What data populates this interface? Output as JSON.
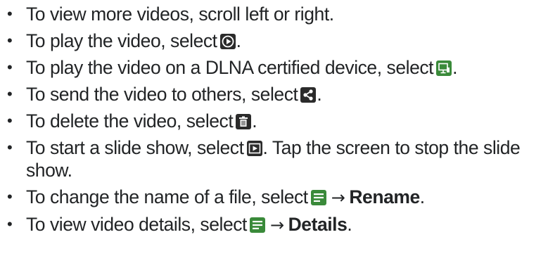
{
  "items": [
    {
      "text": "To view more videos, scroll left or right."
    },
    {
      "before": "To play the video, select",
      "after": ".",
      "icon": "play-circle-icon"
    },
    {
      "before": "To play the video on a DLNA certified device, select",
      "after": ".",
      "icon": "dlna-device-icon"
    },
    {
      "before": "To send the video to others, select",
      "after": ".",
      "icon": "share-icon"
    },
    {
      "before": "To delete the video, select",
      "after": ".",
      "icon": "trash-icon"
    },
    {
      "before": "To start a slide show, select",
      "after": ". Tap the screen to stop the slide show.",
      "icon": "slideshow-icon"
    },
    {
      "before": "To change the name of a file, select",
      "arrow": "→",
      "bold": "Rename",
      "after": ".",
      "icon": "menu-icon"
    },
    {
      "before": "To view video details, select",
      "arrow": "→",
      "bold": "Details",
      "after": ".",
      "icon": "menu-icon"
    }
  ],
  "bullet_glyph": "•",
  "colors": {
    "text": "#222426",
    "icon_dark": "#2b2b2b",
    "icon_green": "#3a8a3a"
  }
}
